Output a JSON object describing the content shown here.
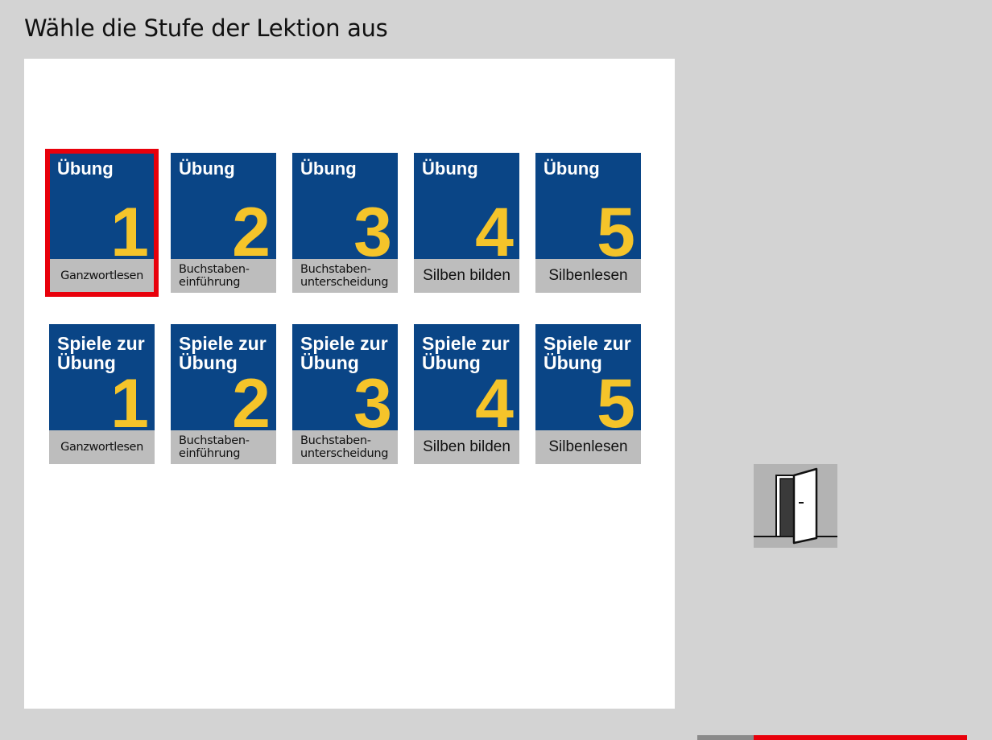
{
  "page_title": "Wähle die Stufe der Lektion aus",
  "exercises": [
    {
      "heading": "Übung",
      "number": "1",
      "label": "Ganzwortlesen",
      "selected": true
    },
    {
      "heading": "Übung",
      "number": "2",
      "label": "Buchstaben-\neinführung",
      "selected": false
    },
    {
      "heading": "Übung",
      "number": "3",
      "label": "Buchstaben-\nunterscheidung",
      "selected": false
    },
    {
      "heading": "Übung",
      "number": "4",
      "label": "Silben bilden",
      "selected": false
    },
    {
      "heading": "Übung",
      "number": "5",
      "label": "Silbenlesen",
      "selected": false
    }
  ],
  "games": [
    {
      "heading": "Spiele zur\nÜbung",
      "number": "1",
      "label": "Ganzwortlesen"
    },
    {
      "heading": "Spiele zur\nÜbung",
      "number": "2",
      "label": "Buchstaben-\neinführung"
    },
    {
      "heading": "Spiele zur\nÜbung",
      "number": "3",
      "label": "Buchstaben-\nunterscheidung"
    },
    {
      "heading": "Spiele zur\nÜbung",
      "number": "4",
      "label": "Silben bilden"
    },
    {
      "heading": "Spiele zur\nÜbung",
      "number": "5",
      "label": "Silbenlesen"
    }
  ],
  "exit_button": {
    "icon": "open-door-icon"
  },
  "colors": {
    "background": "#d3d3d3",
    "tile_blue": "#0a4586",
    "number_yellow": "#f5c42a",
    "label_grey": "#bdbdbd",
    "selection_red": "#e8000b"
  }
}
